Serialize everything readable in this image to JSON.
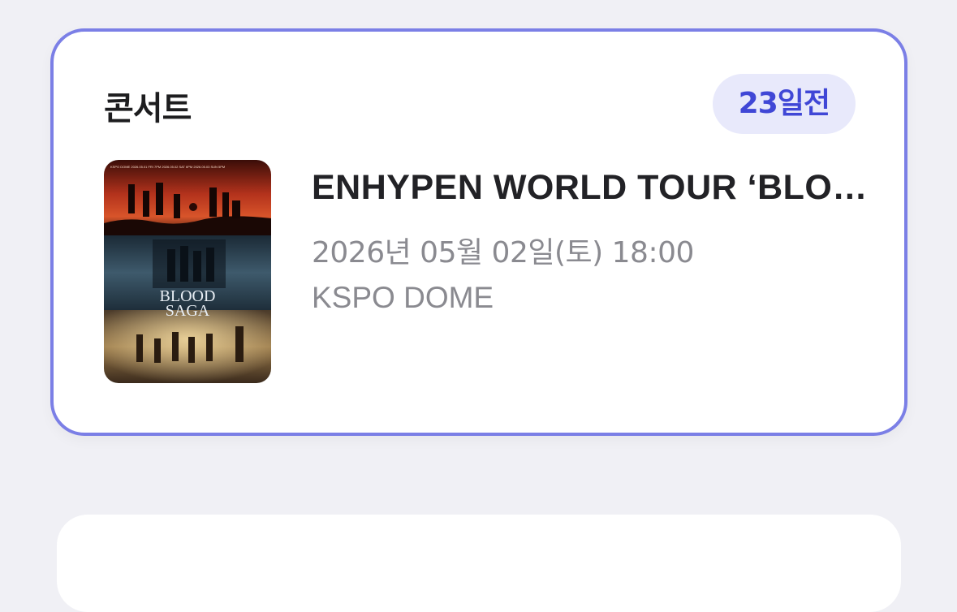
{
  "event": {
    "category": "콘서트",
    "dday_badge": "23일전",
    "title": "ENHYPEN WORLD TOUR ‘BLOOD SAGA’",
    "datetime": "2026년 05월 02일(토) 18:00",
    "venue": "KSPO DOME",
    "poster": {
      "title_line1": "BLOOD",
      "title_line2": "SAGA",
      "top_text": "KSPO DOME  2026.05.01 FRI 7PM  2026.05.02 SAT 6PM  2026.05.03 SUN 5PM"
    }
  },
  "colors": {
    "accent": "#7b7fe6",
    "badge_bg": "#e8e9fb",
    "badge_text": "#4047d6",
    "background": "#f0f0f5"
  }
}
